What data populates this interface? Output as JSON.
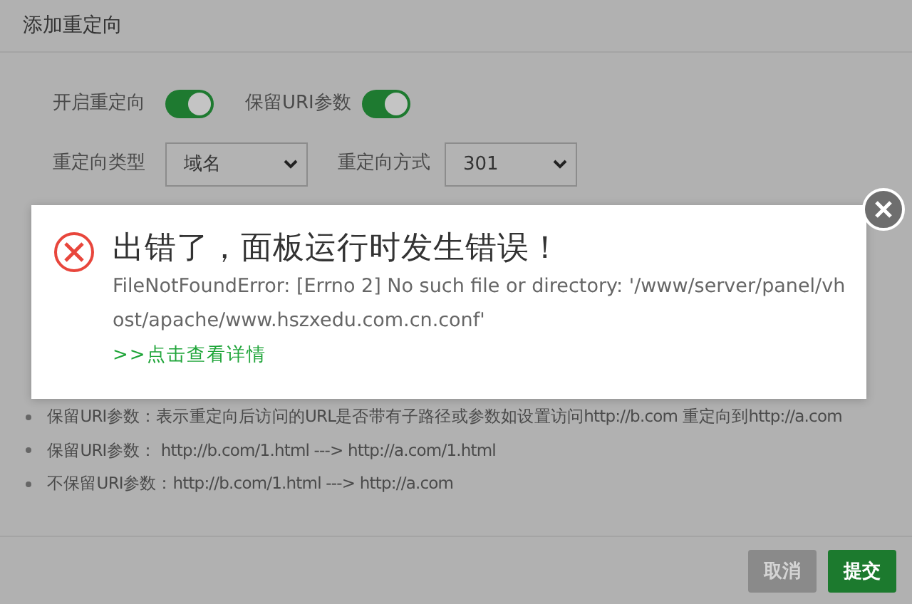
{
  "dialog": {
    "title": "添加重定向"
  },
  "switches": [
    {
      "label": "开启重定向",
      "on": true
    },
    {
      "label": "保留URI参数",
      "on": true
    }
  ],
  "selects": [
    {
      "label": "重定向类型",
      "value": "域名"
    },
    {
      "label": "重定向方式",
      "value": "301"
    }
  ],
  "notes": [
    "保留URI参数：表示重定向后访问的URL是否带有子路径或参数如设置访问http://b.com 重定向到http://a.com",
    "保留URI参数： http://b.com/1.html ---> http://a.com/1.html",
    "不保留URI参数：http://b.com/1.html ---> http://a.com"
  ],
  "buttons": [
    {
      "label": "取消",
      "kind": "cancel",
      "disabled": true
    },
    {
      "label": "提交",
      "kind": "submit",
      "disabled": false
    }
  ],
  "error": {
    "title": "出错了，面板运行时发生错误！",
    "message": "FileNotFoundError: [Errno 2] No such file or directory: '/www/server/panel/vhost/apache/www.hszxedu.com.cn.conf'",
    "link": ">>点击查看详情"
  }
}
